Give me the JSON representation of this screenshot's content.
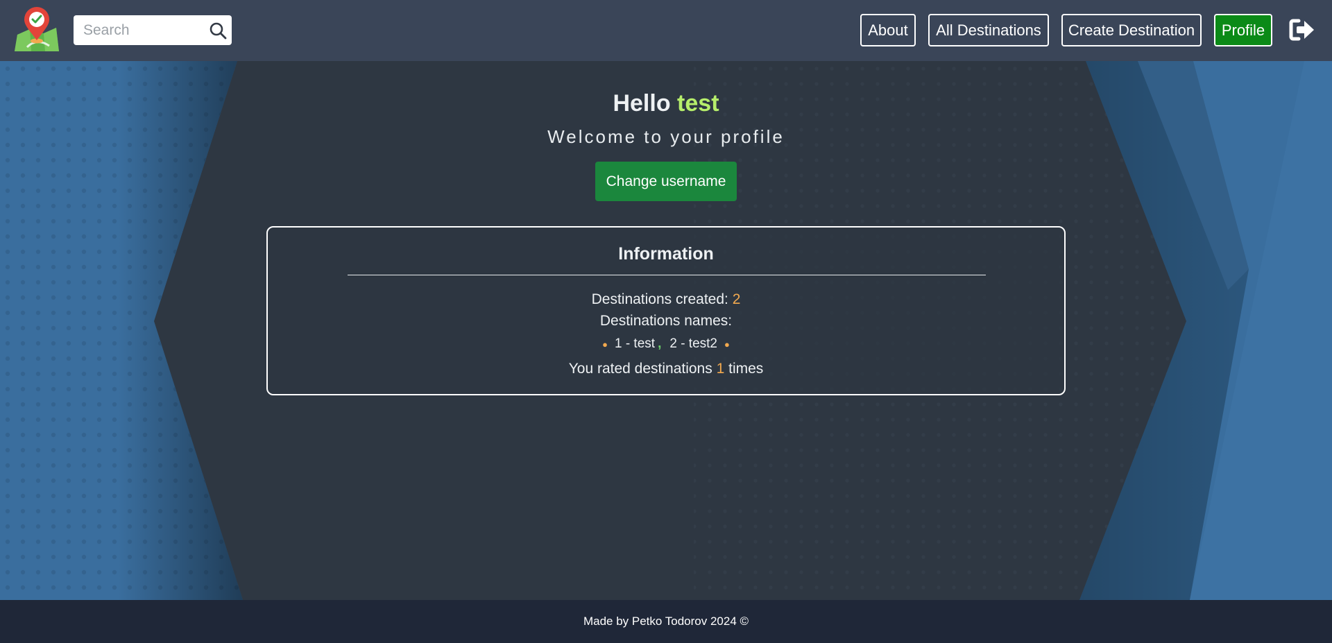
{
  "nav": {
    "search_placeholder": "Search",
    "about_label": "About",
    "all_destinations_label": "All Destinations",
    "create_destination_label": "Create Destination",
    "profile_label": "Profile"
  },
  "profile": {
    "hello_prefix": "Hello",
    "username": "test",
    "welcome_text": "Welcome to your profile",
    "change_username_label": "Change username"
  },
  "info": {
    "title": "Information",
    "destinations_created_label": "Destinations created:",
    "destinations_created_count": "2",
    "destinations_names_label": "Destinations names:",
    "destination_names": [
      "1 - test",
      "2 - test2"
    ],
    "rated_prefix": "You rated destinations",
    "rated_count": "1",
    "rated_suffix": "times"
  },
  "footer": {
    "text": "Made by Petko Todorov 2024 ©"
  },
  "colors": {
    "navbar": "#3a4558",
    "active_nav": "#0b8a17",
    "username_accent": "#b6ee6b",
    "count_accent": "#f2a94f",
    "change_button": "#1b873d",
    "footer": "#1f2738",
    "side_panels": "#3a6e9e"
  },
  "icons": [
    "map-pin-logo-icon",
    "search-icon",
    "logout-icon"
  ]
}
